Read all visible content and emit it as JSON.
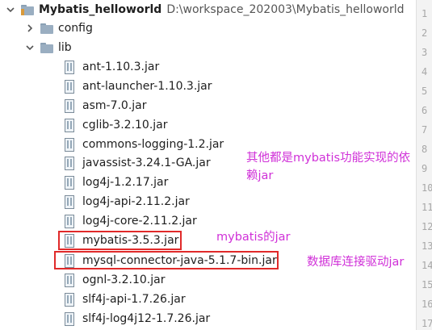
{
  "project": {
    "name": "Mybatis_helloworld",
    "path": "D:\\workspace_202003\\Mybatis_helloworld"
  },
  "folders": [
    {
      "label": "config",
      "expanded": false
    },
    {
      "label": "lib",
      "expanded": true
    }
  ],
  "jars": [
    "ant-1.10.3.jar",
    "ant-launcher-1.10.3.jar",
    "asm-7.0.jar",
    "cglib-3.2.10.jar",
    "commons-logging-1.2.jar",
    "javassist-3.24.1-GA.jar",
    "log4j-1.2.17.jar",
    "log4j-api-2.11.2.jar",
    "log4j-core-2.11.2.jar",
    "mybatis-3.5.3.jar",
    "mysql-connector-java-5.1.7-bin.jar",
    "ognl-3.2.10.jar",
    "slf4j-api-1.7.26.jar",
    "slf4j-log4j12-1.7.26.jar"
  ],
  "annotations": {
    "others_line1": "其他都是mybatis功能实现的依",
    "others_line2": "赖jar",
    "mybatis": "mybatis的jar",
    "driver": "数据库连接驱动jar"
  },
  "gutter_lines": [
    "1",
    "2",
    "3",
    "4",
    "5",
    "6",
    "7",
    "8",
    "9",
    "10",
    "11",
    "12",
    "13",
    "14",
    "15",
    "16",
    "17"
  ],
  "colors": {
    "annotation": "#d030d8",
    "highlight_box": "#e02a2a"
  }
}
